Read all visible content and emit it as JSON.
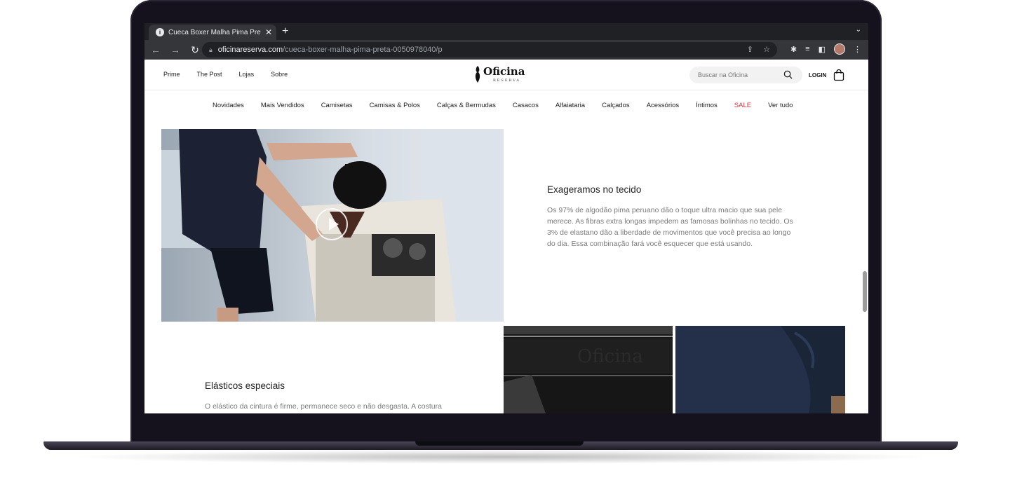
{
  "browser": {
    "tab_title": "Cueca Boxer Malha Pima Preta",
    "tab_favicon": "i",
    "url_host": "oficinareserva.com",
    "url_path": "/cueca-boxer-malha-pima-preta-0050978040/p"
  },
  "header": {
    "top_links": [
      "Prime",
      "The Post",
      "Lojas",
      "Sobre"
    ],
    "logo_text": "Oficina",
    "logo_sub": "RESERVA",
    "search_placeholder": "Buscar na Oficina",
    "login_label": "LOGIN"
  },
  "nav": {
    "items": [
      "Novidades",
      "Mais Vendidos",
      "Camisetas",
      "Camisas & Polos",
      "Calças & Bermudas",
      "Casacos",
      "Alfaiataria",
      "Calçados",
      "Acessórios",
      "Íntimos",
      "SALE",
      "Ver tudo"
    ]
  },
  "sections": [
    {
      "title": "Exageramos no tecido",
      "text": "Os 97% de algodão pima peruano dão o toque ultra macio que sua pele merece. As fibras extra longas impedem as famosas bolinhas no tecido. Os 3% de elastano dão a liberdade de movimentos que você precisa ao longo do dia. Essa combinação fará você esquecer que está usando."
    },
    {
      "title": "Elásticos especiais",
      "text": "O elástico da cintura é firme, permanece seco e não desgasta. A costura"
    }
  ],
  "images": {
    "elastic_band_text": "Oficina"
  },
  "colors": {
    "sale": "#d9343a",
    "chrome_dark": "#202124",
    "chrome_toolbar": "#35363a"
  }
}
